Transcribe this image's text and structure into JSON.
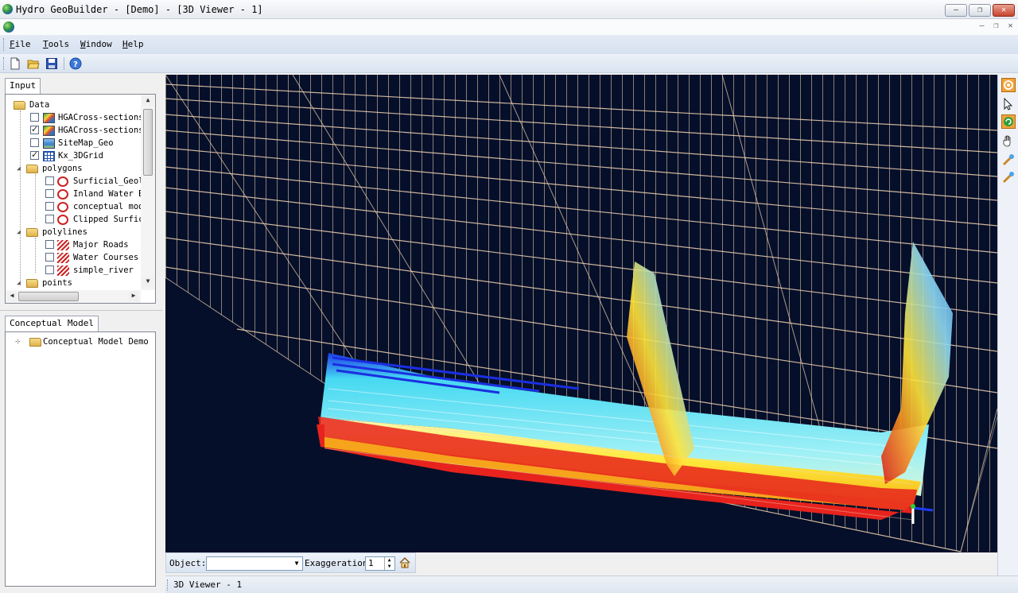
{
  "window": {
    "title": "Hydro GeoBuilder - [Demo] - [3D Viewer - 1]",
    "minimize_symbol": "—",
    "restore_symbol": "❐",
    "close_symbol": "✕"
  },
  "menu": {
    "items": [
      {
        "hotkey": "F",
        "rest": "ile"
      },
      {
        "hotkey": "T",
        "rest": "ools"
      },
      {
        "hotkey": "W",
        "rest": "indow"
      },
      {
        "hotkey": "H",
        "rest": "elp"
      }
    ]
  },
  "toolbar": {
    "icons": [
      "new-document-icon",
      "open-folder-icon",
      "save-disk-icon",
      "help-icon"
    ]
  },
  "input_panel": {
    "tab_label": "Input",
    "tree": {
      "data_folder": "Data",
      "data_items": [
        {
          "label": "HGACross-sections",
          "checked": false,
          "icon": "raster"
        },
        {
          "label": "HGACross-sections",
          "checked": true,
          "icon": "raster"
        },
        {
          "label": "SiteMap_Geo",
          "checked": false,
          "icon": "map"
        },
        {
          "label": "Kx_3DGrid",
          "checked": true,
          "icon": "grid"
        }
      ],
      "polygons_folder": "polygons",
      "polygon_items": [
        {
          "label": "Surficial_Geol",
          "checked": false
        },
        {
          "label": "Inland Water B",
          "checked": false
        },
        {
          "label": "conceptual mod",
          "checked": false
        },
        {
          "label": "Clipped Surfic",
          "checked": false
        }
      ],
      "polylines_folder": "polylines",
      "polyline_items": [
        {
          "label": "Major Roads",
          "checked": false
        },
        {
          "label": "Water Courses",
          "checked": false
        },
        {
          "label": "simple_river",
          "checked": false
        }
      ],
      "points_folder": "points"
    }
  },
  "conceptual_panel": {
    "tab_label": "Conceptual Model",
    "root_label": "Conceptual Model Demo"
  },
  "viewer_controls": {
    "object_label": "Object:",
    "object_value": "",
    "exaggeration_label": "Exaggeration",
    "exaggeration_value": "1"
  },
  "status": {
    "viewer_tab": "3D Viewer - 1"
  },
  "right_tools": {
    "icons": [
      "rotate-view-icon",
      "select-pointer-icon",
      "orbit-icon",
      "pan-hand-icon",
      "zoom-in-icon",
      "zoom-out-icon"
    ]
  },
  "colors": {
    "viewer_background": "#050f2a",
    "grid_lines": "#f3d7b6",
    "layer_red": "#e8231d",
    "layer_yellow": "#ffe63a",
    "layer_cyan": "#3fe3f0",
    "layer_blue": "#1a2fe0"
  }
}
